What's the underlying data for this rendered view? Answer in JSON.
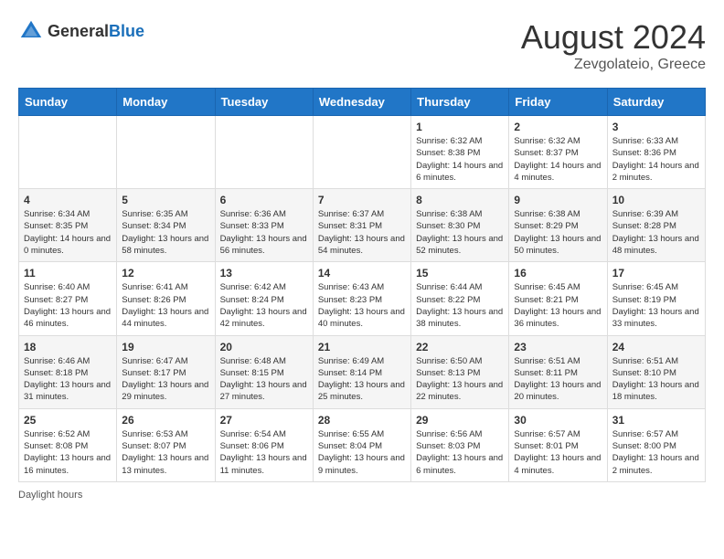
{
  "header": {
    "logo_general": "General",
    "logo_blue": "Blue",
    "month_year": "August 2024",
    "location": "Zevgolateio, Greece"
  },
  "weekdays": [
    "Sunday",
    "Monday",
    "Tuesday",
    "Wednesday",
    "Thursday",
    "Friday",
    "Saturday"
  ],
  "weeks": [
    [
      {
        "day": "",
        "info": ""
      },
      {
        "day": "",
        "info": ""
      },
      {
        "day": "",
        "info": ""
      },
      {
        "day": "",
        "info": ""
      },
      {
        "day": "1",
        "info": "Sunrise: 6:32 AM\nSunset: 8:38 PM\nDaylight: 14 hours and 6 minutes."
      },
      {
        "day": "2",
        "info": "Sunrise: 6:32 AM\nSunset: 8:37 PM\nDaylight: 14 hours and 4 minutes."
      },
      {
        "day": "3",
        "info": "Sunrise: 6:33 AM\nSunset: 8:36 PM\nDaylight: 14 hours and 2 minutes."
      }
    ],
    [
      {
        "day": "4",
        "info": "Sunrise: 6:34 AM\nSunset: 8:35 PM\nDaylight: 14 hours and 0 minutes."
      },
      {
        "day": "5",
        "info": "Sunrise: 6:35 AM\nSunset: 8:34 PM\nDaylight: 13 hours and 58 minutes."
      },
      {
        "day": "6",
        "info": "Sunrise: 6:36 AM\nSunset: 8:33 PM\nDaylight: 13 hours and 56 minutes."
      },
      {
        "day": "7",
        "info": "Sunrise: 6:37 AM\nSunset: 8:31 PM\nDaylight: 13 hours and 54 minutes."
      },
      {
        "day": "8",
        "info": "Sunrise: 6:38 AM\nSunset: 8:30 PM\nDaylight: 13 hours and 52 minutes."
      },
      {
        "day": "9",
        "info": "Sunrise: 6:38 AM\nSunset: 8:29 PM\nDaylight: 13 hours and 50 minutes."
      },
      {
        "day": "10",
        "info": "Sunrise: 6:39 AM\nSunset: 8:28 PM\nDaylight: 13 hours and 48 minutes."
      }
    ],
    [
      {
        "day": "11",
        "info": "Sunrise: 6:40 AM\nSunset: 8:27 PM\nDaylight: 13 hours and 46 minutes."
      },
      {
        "day": "12",
        "info": "Sunrise: 6:41 AM\nSunset: 8:26 PM\nDaylight: 13 hours and 44 minutes."
      },
      {
        "day": "13",
        "info": "Sunrise: 6:42 AM\nSunset: 8:24 PM\nDaylight: 13 hours and 42 minutes."
      },
      {
        "day": "14",
        "info": "Sunrise: 6:43 AM\nSunset: 8:23 PM\nDaylight: 13 hours and 40 minutes."
      },
      {
        "day": "15",
        "info": "Sunrise: 6:44 AM\nSunset: 8:22 PM\nDaylight: 13 hours and 38 minutes."
      },
      {
        "day": "16",
        "info": "Sunrise: 6:45 AM\nSunset: 8:21 PM\nDaylight: 13 hours and 36 minutes."
      },
      {
        "day": "17",
        "info": "Sunrise: 6:45 AM\nSunset: 8:19 PM\nDaylight: 13 hours and 33 minutes."
      }
    ],
    [
      {
        "day": "18",
        "info": "Sunrise: 6:46 AM\nSunset: 8:18 PM\nDaylight: 13 hours and 31 minutes."
      },
      {
        "day": "19",
        "info": "Sunrise: 6:47 AM\nSunset: 8:17 PM\nDaylight: 13 hours and 29 minutes."
      },
      {
        "day": "20",
        "info": "Sunrise: 6:48 AM\nSunset: 8:15 PM\nDaylight: 13 hours and 27 minutes."
      },
      {
        "day": "21",
        "info": "Sunrise: 6:49 AM\nSunset: 8:14 PM\nDaylight: 13 hours and 25 minutes."
      },
      {
        "day": "22",
        "info": "Sunrise: 6:50 AM\nSunset: 8:13 PM\nDaylight: 13 hours and 22 minutes."
      },
      {
        "day": "23",
        "info": "Sunrise: 6:51 AM\nSunset: 8:11 PM\nDaylight: 13 hours and 20 minutes."
      },
      {
        "day": "24",
        "info": "Sunrise: 6:51 AM\nSunset: 8:10 PM\nDaylight: 13 hours and 18 minutes."
      }
    ],
    [
      {
        "day": "25",
        "info": "Sunrise: 6:52 AM\nSunset: 8:08 PM\nDaylight: 13 hours and 16 minutes."
      },
      {
        "day": "26",
        "info": "Sunrise: 6:53 AM\nSunset: 8:07 PM\nDaylight: 13 hours and 13 minutes."
      },
      {
        "day": "27",
        "info": "Sunrise: 6:54 AM\nSunset: 8:06 PM\nDaylight: 13 hours and 11 minutes."
      },
      {
        "day": "28",
        "info": "Sunrise: 6:55 AM\nSunset: 8:04 PM\nDaylight: 13 hours and 9 minutes."
      },
      {
        "day": "29",
        "info": "Sunrise: 6:56 AM\nSunset: 8:03 PM\nDaylight: 13 hours and 6 minutes."
      },
      {
        "day": "30",
        "info": "Sunrise: 6:57 AM\nSunset: 8:01 PM\nDaylight: 13 hours and 4 minutes."
      },
      {
        "day": "31",
        "info": "Sunrise: 6:57 AM\nSunset: 8:00 PM\nDaylight: 13 hours and 2 minutes."
      }
    ]
  ],
  "footer": {
    "daylight_label": "Daylight hours"
  }
}
